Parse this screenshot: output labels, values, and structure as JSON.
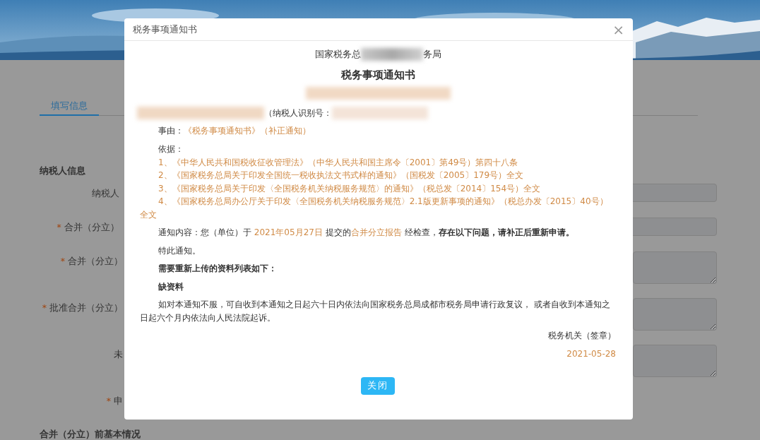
{
  "page": {
    "tabs": [
      {
        "label": "填写信息",
        "selected": true
      }
    ],
    "section_title": "纳税人信息",
    "fields": [
      {
        "label": "纳税人",
        "kind": "input"
      },
      {
        "label": "合并（分立）",
        "required_mark": "*",
        "kind": "input"
      },
      {
        "label": "合并（分立）",
        "required_mark": "*",
        "kind": "textarea"
      },
      {
        "label": "批准合并（分立）",
        "required_mark": "*",
        "kind": "textarea"
      },
      {
        "label": "未",
        "kind": "textarea"
      },
      {
        "label": "申",
        "required_mark": "*",
        "kind": "none"
      }
    ],
    "section_2_title": "合并（分立）前基本情况"
  },
  "modal": {
    "title": "税务事项通知书",
    "close": "×",
    "office_prefix": "国家税务总",
    "office_suffix": "务局",
    "heading": "税务事项通知书",
    "taxpayer_id_label": "（纳税人识别号：",
    "reason_label": "事由：",
    "reason_value": "《税务事项通知书》（补正通知）",
    "basis_label": "依据：",
    "basis": [
      "1、《中华人民共和国税收征收管理法》（中华人民共和国主席令〔2001〕第49号）第四十八条",
      "2、《国家税务总局关于印发全国统一税收执法文书式样的通知》（国税发〔2005〕179号）全文",
      "3、《国家税务总局关于印发〈全国税务机关纳税服务规范〉的通知》（税总发〔2014〕154号）全文",
      "4、《国家税务总局办公厅关于印发〈全国税务机关纳税服务规范〉2.1版更新事项的通知》（税总办发〔2015〕40号）全文"
    ],
    "notice": [
      {
        "kind": "plain",
        "text": "通知内容：您（单位）于 "
      },
      {
        "kind": "highlight",
        "text": "2021年05月27日"
      },
      {
        "kind": "plain",
        "text": " 提交的"
      },
      {
        "kind": "highlight",
        "text": "合并分立报告"
      },
      {
        "kind": "plain",
        "text": " 经检查，"
      },
      {
        "kind": "bold",
        "text": "存在以下问题，请补正后重新申请。"
      }
    ],
    "closing": "特此通知。",
    "list_title": "需要重新上传的资料列表如下：",
    "missing": "缺资料",
    "appeal": "如对本通知不服，可自收到本通知之日起六十日内依法向国家税务总局成都市税务局申请行政复议， 或者自收到本通知之日起六个月内依法向人民法院起诉。",
    "signature": "税务机关（签章）",
    "date": "2021-05-28",
    "button": "关闭"
  }
}
